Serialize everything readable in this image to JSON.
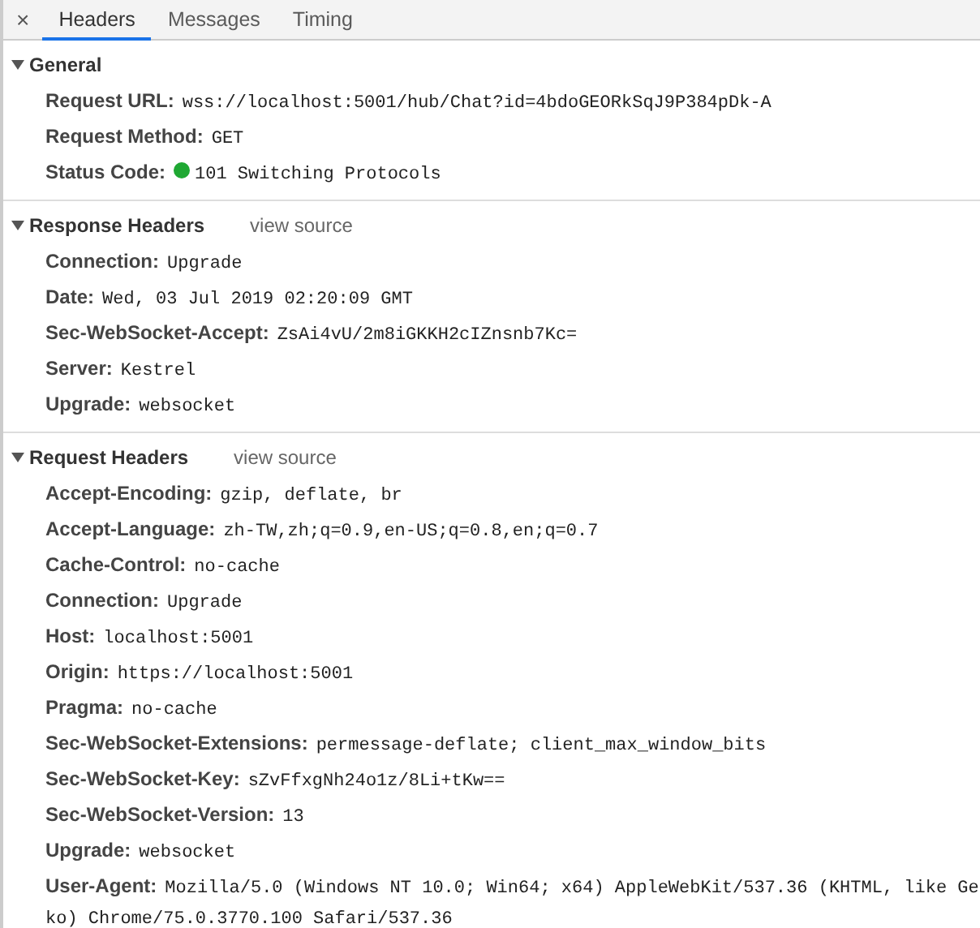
{
  "close_button": "×",
  "tabs": [
    {
      "label": "Headers",
      "selected": true
    },
    {
      "label": "Messages",
      "selected": false
    },
    {
      "label": "Timing",
      "selected": false
    }
  ],
  "sections": [
    {
      "title": "General",
      "expanded": true,
      "rows": [
        {
          "name": "Request URL:",
          "value": "wss://localhost:5001/hub/Chat?id=4bdoGEORkSqJ9P384pDk-A"
        },
        {
          "name": "Request Method:",
          "value": "GET"
        },
        {
          "name": "Status Code:",
          "value": "101 Switching Protocols",
          "color": "#1fa833"
        }
      ]
    },
    {
      "title": "Response Headers",
      "link": "view source",
      "expanded": true,
      "rows": [
        {
          "name": "Connection:",
          "value": "Upgrade"
        },
        {
          "name": "Date:",
          "value": "Wed, 03 Jul 2019 02:20:09 GMT"
        },
        {
          "name": "Sec-WebSocket-Accept:",
          "value": "ZsAi4vU/2m8iGKKH2cIZnsnb7Kc="
        },
        {
          "name": "Server:",
          "value": "Kestrel"
        },
        {
          "name": "Upgrade:",
          "value": "websocket"
        }
      ]
    },
    {
      "title": "Request Headers",
      "link": "view source",
      "expanded": true,
      "rows": [
        {
          "name": "Accept-Encoding:",
          "value": "gzip, deflate, br"
        },
        {
          "name": "Accept-Language:",
          "value": "zh-TW,zh;q=0.9,en-US;q=0.8,en;q=0.7"
        },
        {
          "name": "Cache-Control:",
          "value": "no-cache"
        },
        {
          "name": "Connection:",
          "value": "Upgrade"
        },
        {
          "name": "Host:",
          "value": "localhost:5001"
        },
        {
          "name": "Origin:",
          "value": "https://localhost:5001"
        },
        {
          "name": "Pragma:",
          "value": "no-cache"
        },
        {
          "name": "Sec-WebSocket-Extensions:",
          "value": "permessage-deflate; client_max_window_bits"
        },
        {
          "name": "Sec-WebSocket-Key:",
          "value": "sZvFfxgNh24o1z/8Li+tKw=="
        },
        {
          "name": "Sec-WebSocket-Version:",
          "value": "13"
        },
        {
          "name": "Upgrade:",
          "value": "websocket"
        },
        {
          "name": "User-Agent:",
          "value": "Mozilla/5.0 (Windows NT 10.0; Win64; x64) AppleWebKit/537.36 (KHTML, like Ge",
          "continuation": "ko) Chrome/75.0.3770.100 Safari/537.36"
        }
      ]
    }
  ]
}
